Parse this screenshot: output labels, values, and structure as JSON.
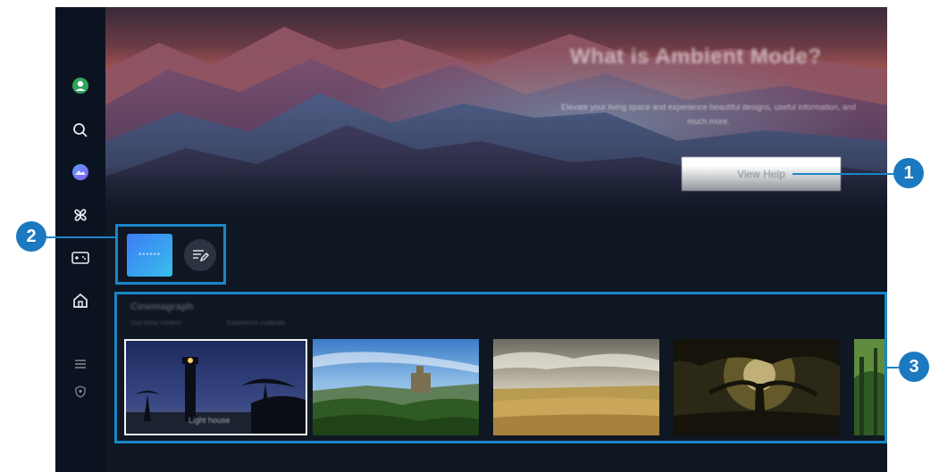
{
  "hero": {
    "title": "What is Ambient Mode?",
    "description": "Elevate your living space and experience beautiful designs, useful information, and much more.",
    "button_label": "View Help"
  },
  "quick_access": {
    "tile_label": "******"
  },
  "content": {
    "section_title": "Cinemagraph",
    "subtitles": [
      "Just show content",
      "Experience multitude"
    ],
    "thumbnails": [
      {
        "caption": "Light house",
        "selected": true
      },
      {
        "caption": "",
        "selected": false
      },
      {
        "caption": "",
        "selected": false
      },
      {
        "caption": "",
        "selected": false
      },
      {
        "caption": "",
        "selected": false
      }
    ]
  },
  "sidebar": {
    "icons": [
      "profile-icon",
      "search-icon",
      "ambient-icon",
      "apps-icon",
      "game-icon",
      "home-icon",
      "menu-icon",
      "privacy-icon"
    ]
  },
  "callouts": [
    "1",
    "2",
    "3"
  ],
  "colors": {
    "accent": "#1a86c8",
    "callout": "#1b79c0",
    "background": "#0f1723"
  }
}
